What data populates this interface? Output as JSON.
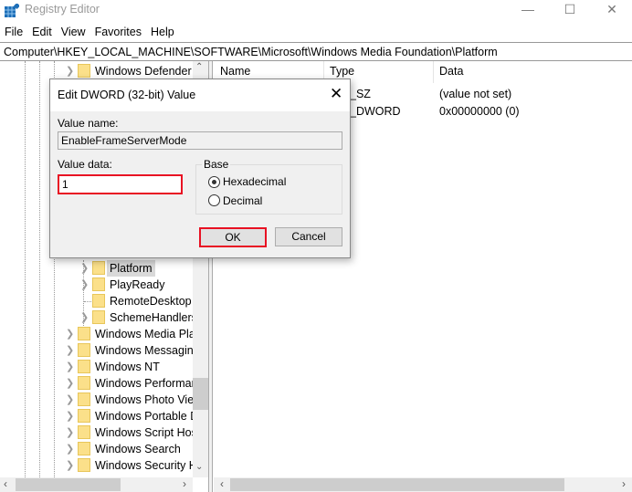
{
  "window": {
    "title": "Registry Editor",
    "minimize": "—",
    "maximize": "☐",
    "close": "✕"
  },
  "menu": [
    "File",
    "Edit",
    "View",
    "Favorites",
    "Help"
  ],
  "address": "Computer\\HKEY_LOCAL_MACHINE\\SOFTWARE\\Microsoft\\Windows Media Foundation\\Platform",
  "tree": {
    "top_item": "Windows Defender S",
    "children": [
      {
        "label": "Platform",
        "expandable": true,
        "selected": true
      },
      {
        "label": "PlayReady",
        "expandable": true
      },
      {
        "label": "RemoteDesktop",
        "expandable": false
      },
      {
        "label": "SchemeHandlers",
        "expandable": true
      }
    ],
    "siblings": [
      "Windows Media Play",
      "Windows Messaging",
      "Windows NT",
      "Windows Performar",
      "Windows Photo View",
      "Windows Portable D",
      "Windows Script Hos",
      "Windows Search",
      "Windows Security H"
    ]
  },
  "list": {
    "columns": [
      "Name",
      "Type",
      "Data"
    ],
    "rows": [
      {
        "type": "_SZ",
        "data": "(value not set)"
      },
      {
        "type": "_DWORD",
        "data": "0x00000000 (0)"
      }
    ]
  },
  "dialog": {
    "title": "Edit DWORD (32-bit) Value",
    "close": "✕",
    "value_name_label": "Value name:",
    "value_name": "EnableFrameServerMode",
    "value_data_label": "Value data:",
    "value_data": "1",
    "base_label": "Base",
    "base_options": [
      "Hexadecimal",
      "Decimal"
    ],
    "base_selected": "Hexadecimal",
    "ok": "OK",
    "cancel": "Cancel"
  },
  "colors": {
    "highlight": "#e81123",
    "folder": "#fbe08a"
  }
}
